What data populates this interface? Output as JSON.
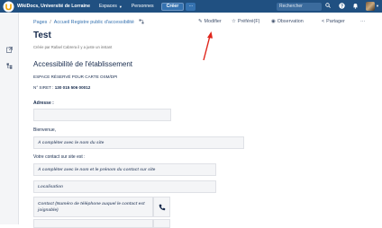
{
  "topbar": {
    "app_name": "WikiDocs, Université de Lorraine",
    "nav": [
      "Espaces",
      "Personnes"
    ],
    "create_label": "Créer",
    "more_label": "···",
    "search_placeholder": "Rechercher"
  },
  "breadcrumb": {
    "items": [
      "Pages",
      "Accueil Registre public d'accessibilité"
    ]
  },
  "page_actions": {
    "edit": "Modifier",
    "favorite": "Préféré(F)",
    "watch": "Observation",
    "share": "Partager",
    "more": "···"
  },
  "page": {
    "title": "Test",
    "byline": "Créée par Rafael Cabrera il y a juste un instant",
    "section_title": "Accessibilité de l'établissement",
    "reserved_space": "ESPACE RÉSERVÉ POUR CARTE OSM/DPI",
    "siret_label": "N° SIRET :",
    "siret_value": "130 015 506 00012",
    "address_label": "Adresse :",
    "welcome_label": "Bienvenue,",
    "site_placeholder": "À compléter avec le nom du site",
    "contact_label": "Votre contact sur site est :",
    "contact_placeholder": "À compléter avec le nom et le prénom du contact sur site",
    "location_placeholder": "Localisation",
    "phone_placeholder": "Contact (Numéro de téléphone auquel le contact est joignable)"
  },
  "colors": {
    "topbar": "#205081",
    "link": "#3572b0",
    "annotation_arrow": "#e0251b"
  }
}
